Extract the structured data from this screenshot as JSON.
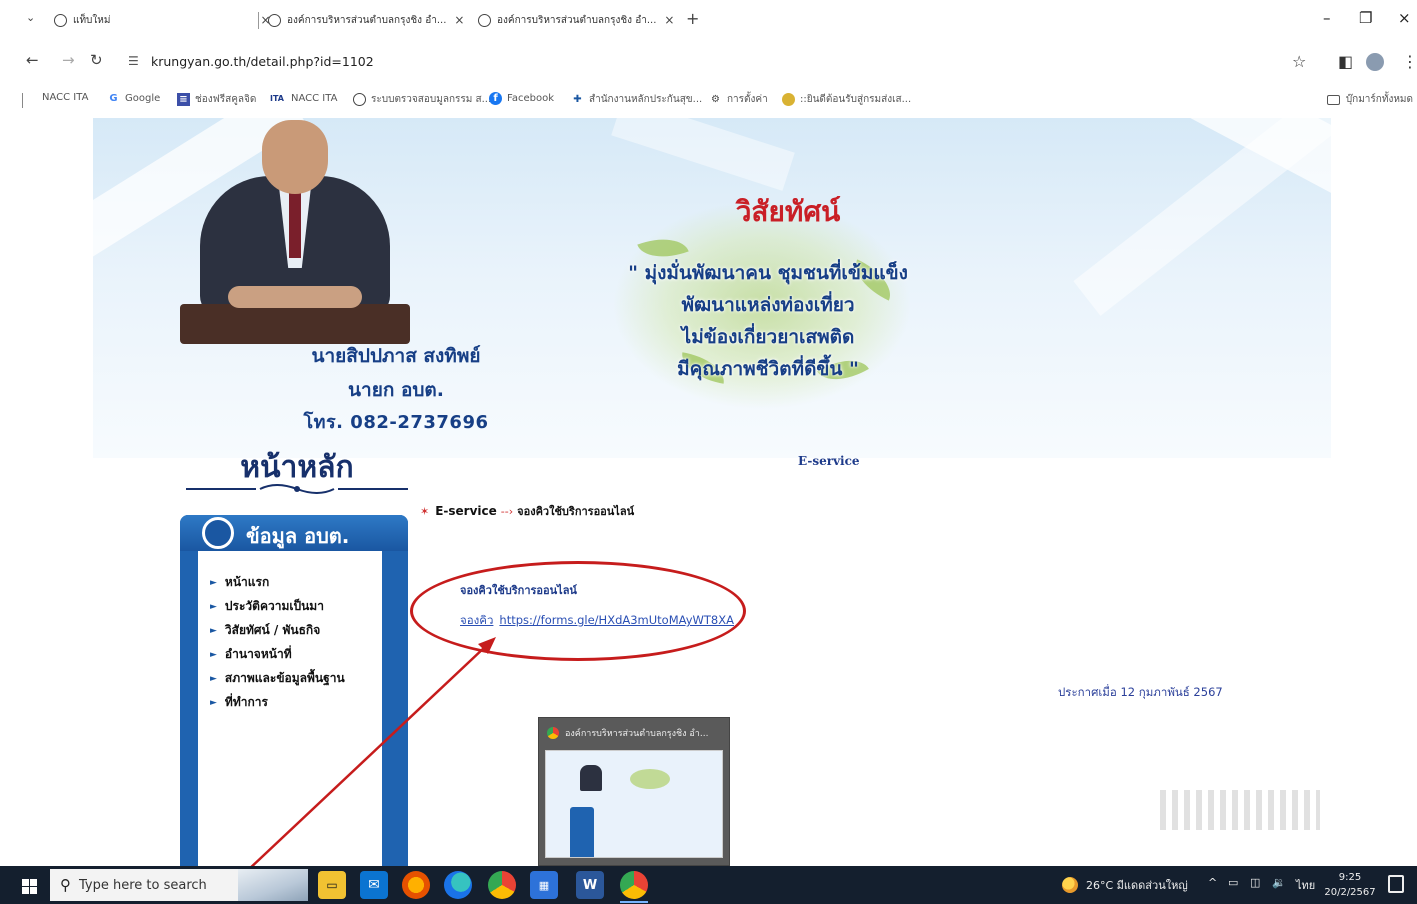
{
  "browser": {
    "tabs": [
      {
        "title": "แท็บใหม่"
      },
      {
        "title": "องค์การบริหารส่วนตำบลกรุงชิง อำ..."
      },
      {
        "title": "องค์การบริหารส่วนตำบลกรุงชิง อำ..."
      }
    ],
    "url": "krungyan.go.th/detail.php?id=1102",
    "bookmarks": [
      {
        "label": "NACC ITA",
        "icon": "text-only"
      },
      {
        "label": "Google",
        "icon": "google-icon"
      },
      {
        "label": "ช่องฟรีสคูลจิด",
        "icon": "sheet-icon"
      },
      {
        "label": "NACC ITA",
        "icon": "ita-icon"
      },
      {
        "label": "ระบบตรวจสอบมูลกรรม ส...",
        "icon": "globe-icon"
      },
      {
        "label": "Facebook",
        "icon": "facebook-icon"
      },
      {
        "label": "สำนักงานหลักประกันสุข...",
        "icon": "health-icon"
      },
      {
        "label": "การตั้งค่า",
        "icon": "gear-icon"
      },
      {
        "label": "::ยินดีต้อนรับสู่กรมส่งเส...",
        "icon": "emblem-icon"
      }
    ],
    "bookmarks_folder": "บุ๊กมาร์กทั้งหมด"
  },
  "page": {
    "mayor": {
      "name": "นายสิปปภาส สงทิพย์",
      "position": "นายก อบต.",
      "phone": "โทร. 082-2737696"
    },
    "vision": {
      "title": "วิสัยทัศน์",
      "lines": [
        "\" มุ่งมั่นพัฒนาคน ชุมชนที่เข้มแข็ง",
        "พัฒนาแหล่งท่องเที่ยว",
        "ไม่ข้องเกี่ยวยาเสพติด",
        "มีคุณภาพชีวิตที่ดีขึ้น \""
      ]
    },
    "home_title": "หน้าหลัก",
    "sidebar": {
      "title": "ข้อมูล อบต.",
      "items": [
        {
          "label": "หน้าแรก"
        },
        {
          "label": "ประวัติความเป็นมา"
        },
        {
          "label": "วิสัยทัศน์ / พันธกิจ"
        },
        {
          "label": "อำนาจหน้าที่"
        },
        {
          "label": "สภาพและข้อมูลพื้นฐาน"
        },
        {
          "label": "ที่ทำการ"
        }
      ]
    },
    "breadcrumb": {
      "section": "E-service",
      "current": "จองคิวใช้บริการออนไลน์"
    },
    "eservice_heading": "E-service",
    "booking": {
      "title": "จองคิวใช้บริการออนไลน์",
      "link_prefix": "จองคิว",
      "link_url": "https://forms.gle/HXdA3mUtoMAyWT8XA"
    },
    "announcement": "ประกาศเมื่อ 12 กุมภาพันธ์ 2567",
    "thumbnail_title": "องค์การบริหารส่วนตำบลกรุงชิง อำ..."
  },
  "taskbar": {
    "search_placeholder": "Type here to search",
    "weather": "26°C มีแดดส่วนใหญ่",
    "language": "ไทย",
    "time": "9:25",
    "date": "20/2/2567"
  },
  "colors": {
    "sidebar_blue": "#1f63b0",
    "title_navy": "#173f86",
    "vision_red": "#c91f26",
    "annotation_red": "#c61c1c",
    "link_blue": "#2a4fb4",
    "taskbar_bg": "#141f2e"
  }
}
